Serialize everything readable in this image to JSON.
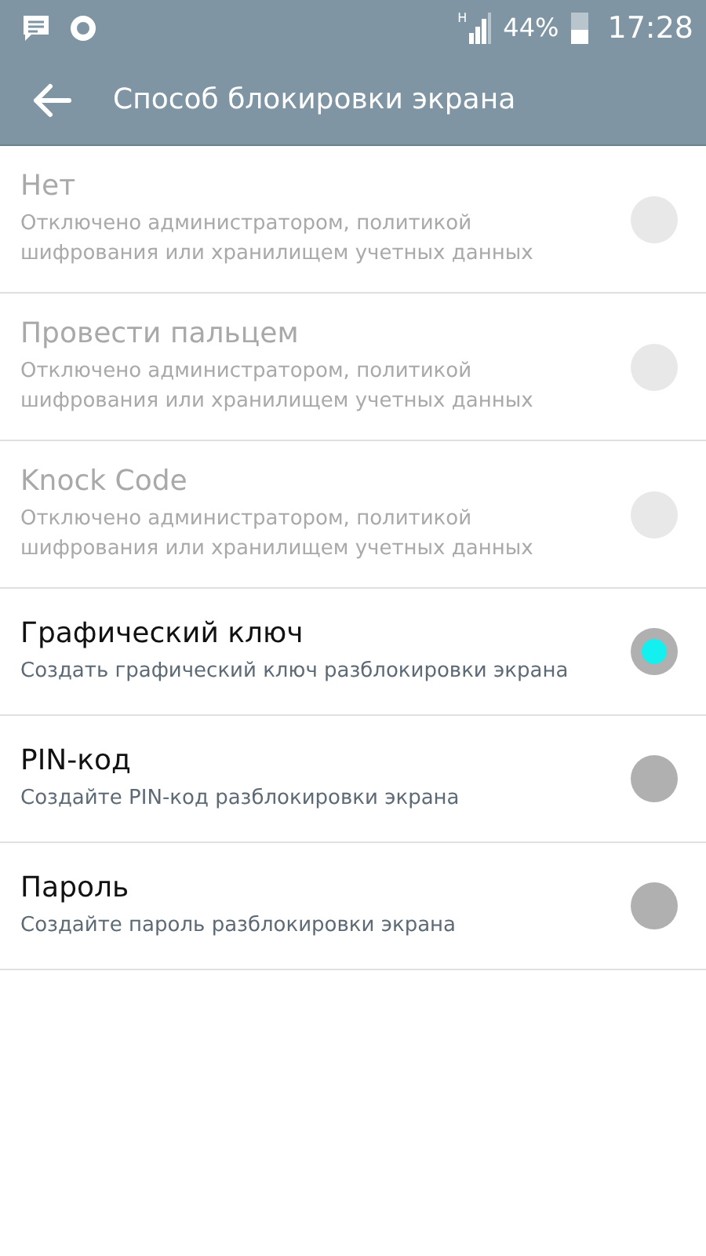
{
  "status_bar": {
    "network": "H",
    "battery": "44%",
    "time": "17:28"
  },
  "app_bar": {
    "title": "Способ блокировки экрана"
  },
  "options": [
    {
      "title": "Нет",
      "summary": "Отключено администратором, политикой шифрования или хранилищем учетных данных",
      "disabled": true,
      "selected": false
    },
    {
      "title": "Провести пальцем",
      "summary": "Отключено администратором, политикой шифрования или хранилищем учетных данных",
      "disabled": true,
      "selected": false
    },
    {
      "title": "Knock Code",
      "summary": "Отключено администратором, политикой шифрования или хранилищем учетных данных",
      "disabled": true,
      "selected": false
    },
    {
      "title": "Графический ключ",
      "summary": "Создать графический ключ разблокировки экрана",
      "disabled": false,
      "selected": true
    },
    {
      "title": "PIN-код",
      "summary": "Создайте PIN-код разблокировки экрана",
      "disabled": false,
      "selected": false
    },
    {
      "title": "Пароль",
      "summary": "Создайте пароль разблокировки экрана",
      "disabled": false,
      "selected": false
    }
  ]
}
